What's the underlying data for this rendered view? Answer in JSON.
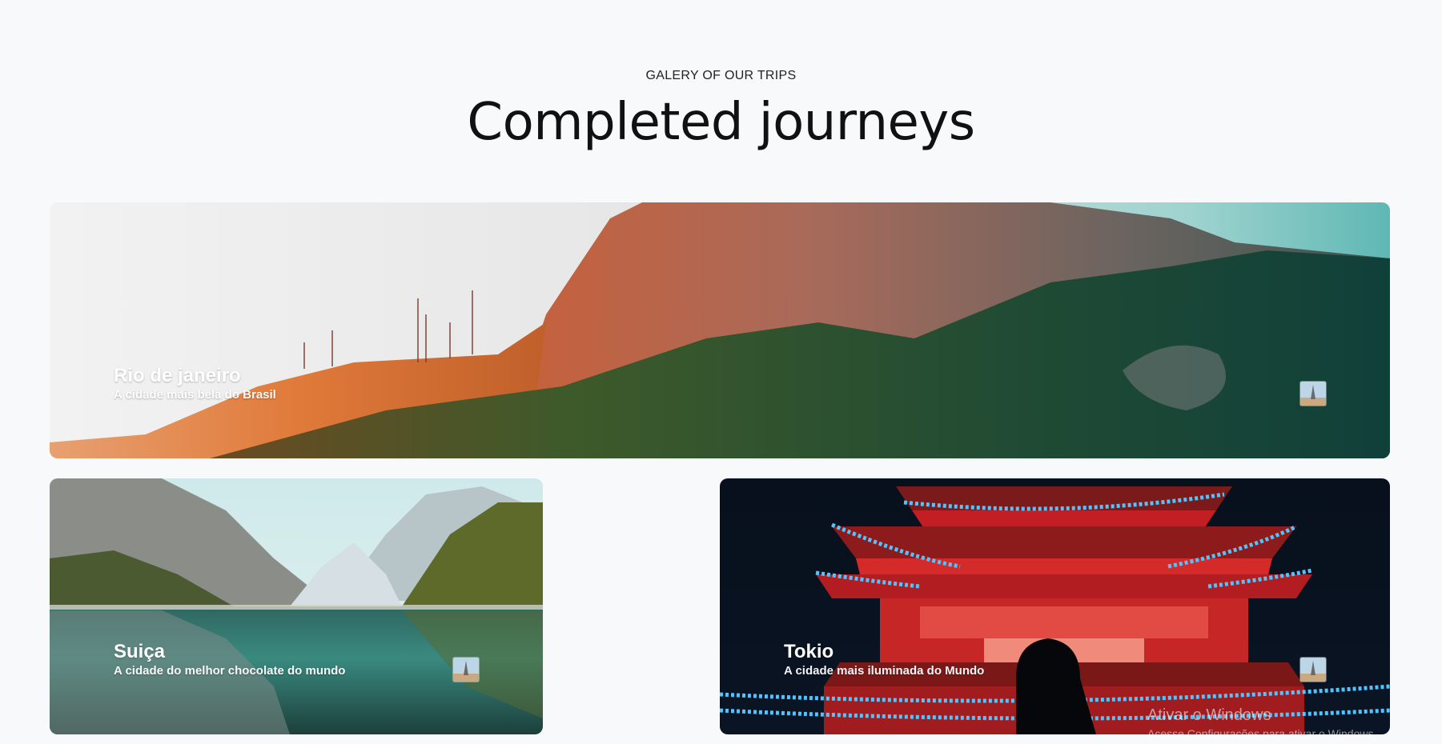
{
  "header": {
    "eyebrow": "GALERY OF OUR TRIPS",
    "title": "Completed journeys"
  },
  "trips": [
    {
      "title": "Rio de janeiro",
      "subtitle": "A cidade mais bela do Brasil",
      "image": "rio-mountain-photo"
    },
    {
      "title": "Suiça",
      "subtitle": "A cidade do melhor chocolate do mundo",
      "image": "swiss-lake-photo"
    },
    {
      "title": "Tokio",
      "subtitle": "A cidade mais iluminada do Mundo",
      "image": "tokyo-pagoda-photo"
    }
  ],
  "watermark": {
    "line1": "Ativar o Windows",
    "line2": "Acesse Configurações para ativar o Windows."
  },
  "colors": {
    "page_bg": "#f8f9fa",
    "text_dark": "#111111",
    "caption_text": "#ffffff"
  }
}
